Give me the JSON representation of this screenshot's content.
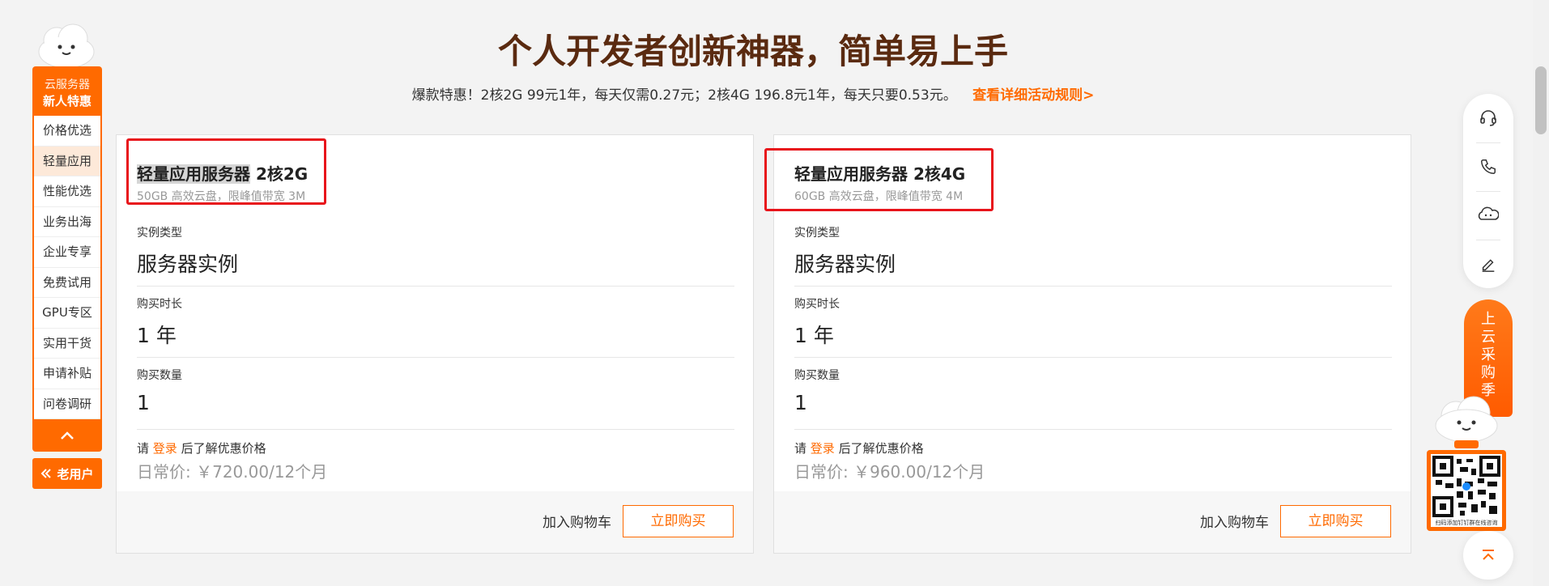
{
  "header": {
    "title": "个人开发者创新神器，简单易上手",
    "promo_text": "爆款特惠！2核2G 99元1年，每天仅需0.27元；2核4G 196.8元1年，每天只要0.53元。",
    "rules_link": "查看详细活动规则>"
  },
  "left_nav": {
    "head_small": "云服务器",
    "head_big": "新人特惠",
    "items": [
      "价格优选",
      "轻量应用",
      "性能优选",
      "业务出海",
      "企业专享",
      "免费试用",
      "GPU专区",
      "实用干货",
      "申请补贴",
      "问卷调研"
    ],
    "active_index": 1,
    "old_user": "老用户"
  },
  "cards": [
    {
      "title_highlight": "轻量应用服务器",
      "title_spec": " 2核2G",
      "subtitle": "50GB 高效云盘，限峰值带宽 3M",
      "instance_label": "实例类型",
      "instance_value": "服务器实例",
      "duration_label": "购买时长",
      "duration_value": "1 年",
      "quantity_label": "购买数量",
      "quantity_value": "1",
      "login_prefix": "请 ",
      "login_link": "登录",
      "login_suffix": " 后了解优惠价格",
      "daily_price": "日常价: ￥720.00/12个月",
      "add_cart": "加入购物车",
      "buy_now": "立即购买"
    },
    {
      "title_highlight": "轻量应用服务器",
      "title_spec": " 2核4G",
      "subtitle": "60GB 高效云盘，限峰值带宽 4M",
      "instance_label": "实例类型",
      "instance_value": "服务器实例",
      "duration_label": "购买时长",
      "duration_value": "1 年",
      "quantity_label": "购买数量",
      "quantity_value": "1",
      "login_prefix": "请 ",
      "login_link": "登录",
      "login_suffix": " 后了解优惠价格",
      "daily_price": "日常价: ￥960.00/12个月",
      "add_cart": "加入购物车",
      "buy_now": "立即购买"
    }
  ],
  "right_tools": {
    "icons": [
      "headset-icon",
      "phone-icon",
      "chat-bot-icon",
      "edit-icon"
    ],
    "season_chars": [
      "上",
      "云",
      "采",
      "购",
      "季"
    ],
    "qr_caption": "扫码添加钉钉群在线咨询"
  },
  "colors": {
    "accent": "#ff6a00",
    "title": "#5a2a10",
    "highlight_box": "#e8141b"
  }
}
